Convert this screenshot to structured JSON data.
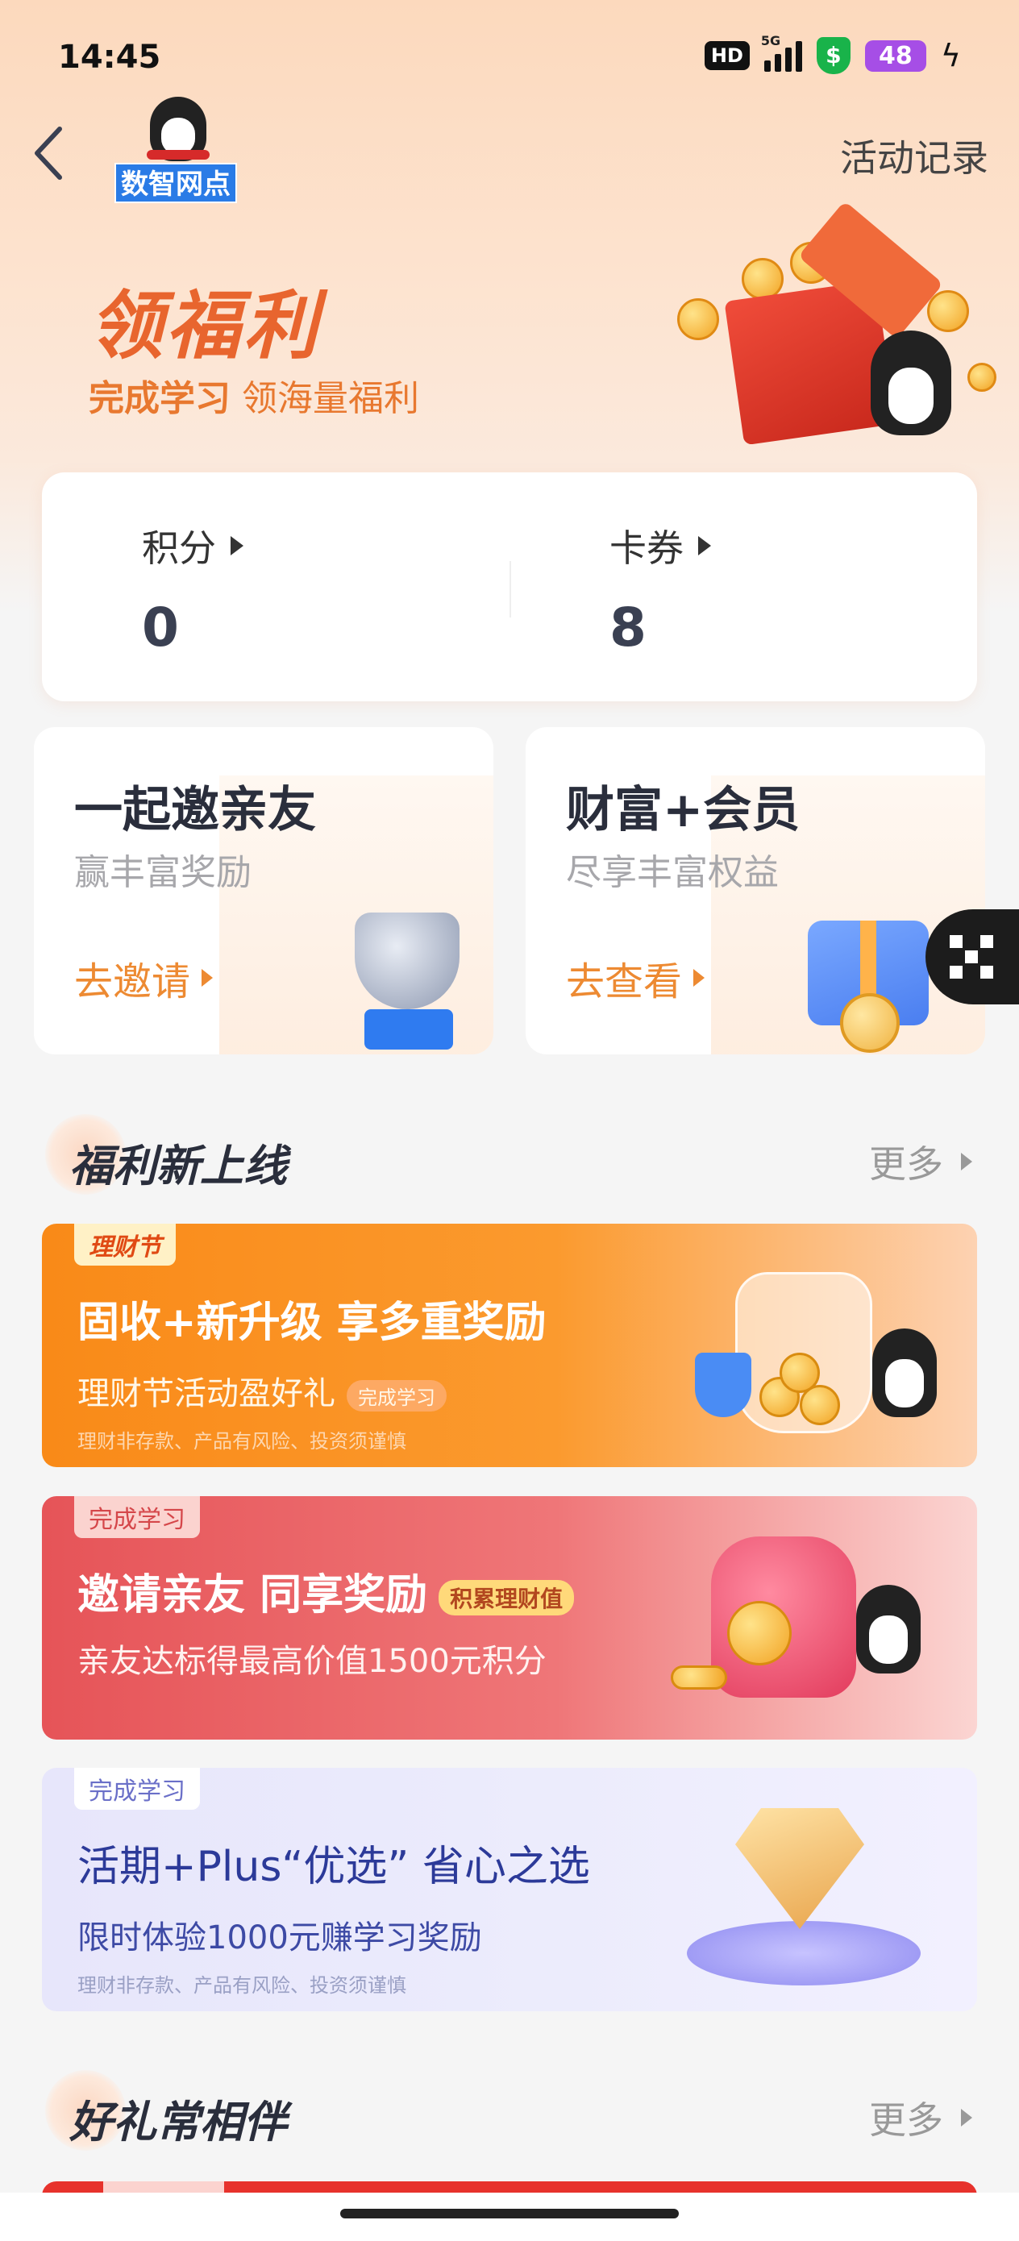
{
  "status_bar": {
    "time": "14:45",
    "hd": "HD",
    "network": "5G",
    "shield": "$",
    "battery": "48"
  },
  "nav": {
    "logo_label": "数智网点",
    "activity_record": "活动记录"
  },
  "hero": {
    "title": "领福利",
    "subtitle_bold": "完成学习",
    "subtitle_rest": " 领海量福利"
  },
  "points_card": {
    "points_label": "积分",
    "points_value": "0",
    "coupons_label": "卡券",
    "coupons_value": "8"
  },
  "promos": [
    {
      "title": "一起邀亲友",
      "subtitle": "赢丰富奖励",
      "cta": "去邀请"
    },
    {
      "title": "财富+会员",
      "subtitle": "尽享丰富权益",
      "cta": "去查看"
    }
  ],
  "section_new": {
    "title": "福利新上线",
    "more": "更多"
  },
  "banners": [
    {
      "tag": "理财节",
      "title": "固收+新升级 享多重奖励",
      "subtitle": "理财节活动盈好礼",
      "subtitle_badge": "完成学习",
      "disclaimer": "理财非存款、产品有风险、投资须谨慎"
    },
    {
      "tag": "完成学习",
      "title": "邀请亲友 同享奖励",
      "title_badge": "积累理财值",
      "subtitle": "亲友达标得最高价值1500元积分"
    },
    {
      "tag": "完成学习",
      "title": "活期+Plus“优选” 省心之选",
      "subtitle": "限时体验1000元赚学习奖励",
      "disclaimer": "理财非存款、产品有风险、投资须谨慎"
    }
  ],
  "section_gifts": {
    "title": "好礼常相伴",
    "more": "更多"
  }
}
